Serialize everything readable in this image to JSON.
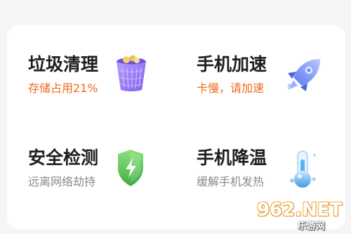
{
  "tiles": [
    {
      "title": "垃圾清理",
      "subtitle": "存储占用21%",
      "subtitle_color": "#ee6a1f",
      "icon": "trash-bin-icon"
    },
    {
      "title": "手机加速",
      "subtitle": "卡慢，请加速",
      "subtitle_color": "#ee6a1f",
      "icon": "rocket-icon"
    },
    {
      "title": "安全检测",
      "subtitle": "远离网络劫持",
      "subtitle_color": "#8a8a8a",
      "icon": "shield-lightning-icon"
    },
    {
      "title": "手机降温",
      "subtitle": "缓解手机发热",
      "subtitle_color": "#8a8a8a",
      "icon": "thermometer-icon"
    }
  ],
  "watermark": {
    "main": "962.NET",
    "sub": "乐游网"
  }
}
